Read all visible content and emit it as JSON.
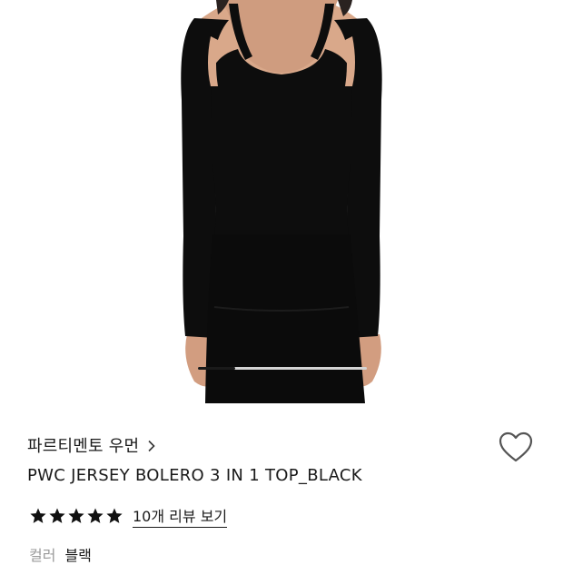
{
  "product": {
    "brand": "파르티멘토 우먼",
    "title": "PWC JERSEY BOLERO 3 IN 1 TOP_BLACK",
    "rating_stars": 5,
    "review_link": "10개 리뷰 보기",
    "option_label": "컬러",
    "option_value": "블랙"
  },
  "gallery": {
    "scroll_progress": 0.22
  },
  "icons": {
    "brand_chevron": "chevron-right-icon",
    "wishlist": "heart-outline-icon",
    "star": "star-filled-icon"
  },
  "colors": {
    "text": "#1a1a1a",
    "muted": "#9a9a9a",
    "garment": "#0d0d0d",
    "skin": "#d9a88a"
  }
}
